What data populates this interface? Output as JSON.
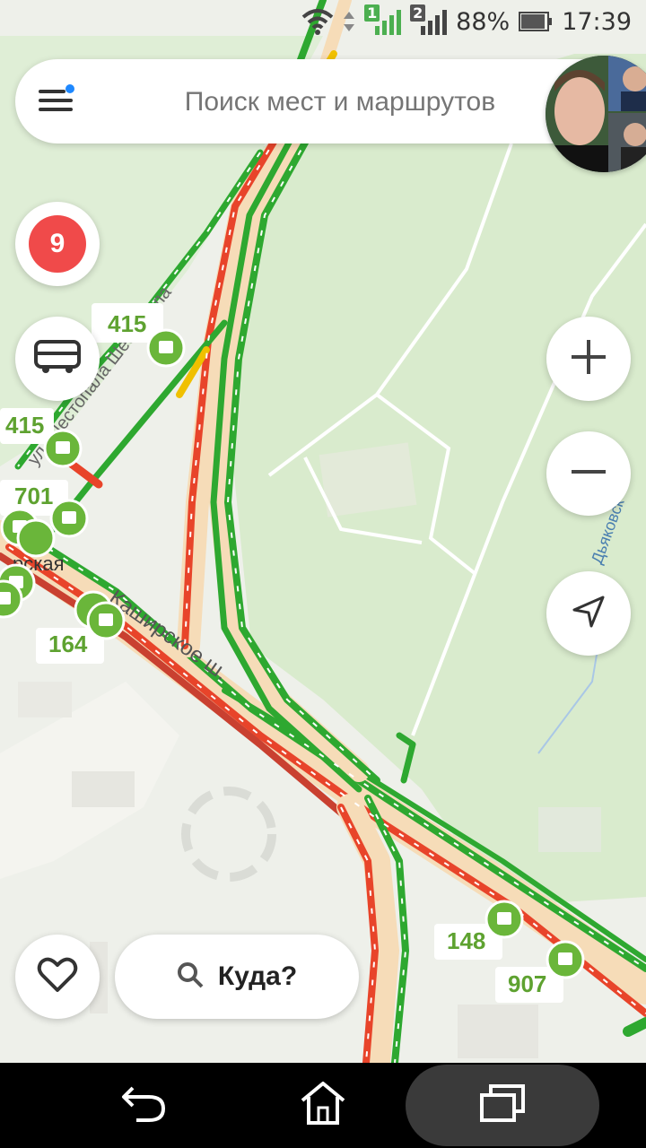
{
  "status": {
    "battery": "88%",
    "time": "17:39",
    "sim1": "1",
    "sim2": "2"
  },
  "search": {
    "placeholder": "Поиск мест и маршрутов"
  },
  "traffic": {
    "level": "9"
  },
  "where": {
    "label": "Куда?"
  },
  "map": {
    "route_labels": [
      "415",
      "415",
      "701",
      "164",
      "148",
      "907"
    ],
    "streets": {
      "kashirskoe": "Каширское ш.",
      "shestopala": "ул. Шестопала Шестопала",
      "dyakov": "Дьяковск",
      "station": "рская"
    }
  },
  "colors": {
    "jam": "#e8442a",
    "free": "#2ea830",
    "slow": "#f0c000",
    "park": "#dcebd2",
    "bus": "#6ab63a"
  },
  "icons": {
    "menu": "menu-icon",
    "bus": "bus-icon",
    "plus": "zoom-in-icon",
    "minus": "zoom-out-icon",
    "location": "location-arrow-icon",
    "heart": "heart-icon",
    "search": "search-icon",
    "back": "back-icon",
    "home": "home-icon",
    "recents": "recents-icon"
  }
}
